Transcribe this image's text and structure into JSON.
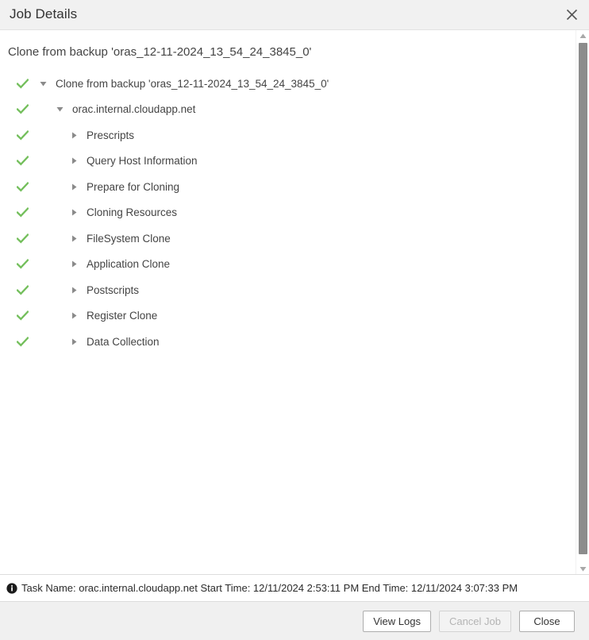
{
  "window": {
    "title": "Job Details",
    "close_icon": "close-icon"
  },
  "main": {
    "heading": "Clone from backup 'oras_12-11-2024_13_54_24_3845_0'",
    "tree": [
      {
        "label": "Clone from backup 'oras_12-11-2024_13_54_24_3845_0'",
        "level": 0,
        "expanded": true,
        "status": "success",
        "status_icon": "check-icon"
      },
      {
        "label": "orac.internal.cloudapp.net",
        "level": 1,
        "expanded": true,
        "status": "success",
        "status_icon": "check-icon"
      },
      {
        "label": "Prescripts",
        "level": 2,
        "expanded": false,
        "status": "success",
        "status_icon": "check-icon"
      },
      {
        "label": "Query Host Information",
        "level": 2,
        "expanded": false,
        "status": "success",
        "status_icon": "check-icon"
      },
      {
        "label": "Prepare for Cloning",
        "level": 2,
        "expanded": false,
        "status": "success",
        "status_icon": "check-icon"
      },
      {
        "label": "Cloning Resources",
        "level": 2,
        "expanded": false,
        "status": "success",
        "status_icon": "check-icon"
      },
      {
        "label": "FileSystem Clone",
        "level": 2,
        "expanded": false,
        "status": "success",
        "status_icon": "check-icon"
      },
      {
        "label": "Application Clone",
        "level": 2,
        "expanded": false,
        "status": "success",
        "status_icon": "check-icon"
      },
      {
        "label": "Postscripts",
        "level": 2,
        "expanded": false,
        "status": "success",
        "status_icon": "check-icon"
      },
      {
        "label": "Register Clone",
        "level": 2,
        "expanded": false,
        "status": "success",
        "status_icon": "check-icon"
      },
      {
        "label": "Data Collection",
        "level": 2,
        "expanded": false,
        "status": "success",
        "status_icon": "check-icon"
      }
    ]
  },
  "statusbar": {
    "icon": "info-icon",
    "text": "Task Name: orac.internal.cloudapp.net Start Time: 12/11/2024 2:53:11 PM End Time: 12/11/2024 3:07:33 PM"
  },
  "footer": {
    "view_logs_label": "View Logs",
    "cancel_job_label": "Cancel Job",
    "cancel_job_disabled": true,
    "close_label": "Close"
  },
  "colors": {
    "success_green": "#74bf5c",
    "titlebar_bg": "#f1f1f1",
    "footer_bg": "#f0f0f0",
    "text": "#444444",
    "scrollbar_thumb": "#8c8c8c"
  }
}
